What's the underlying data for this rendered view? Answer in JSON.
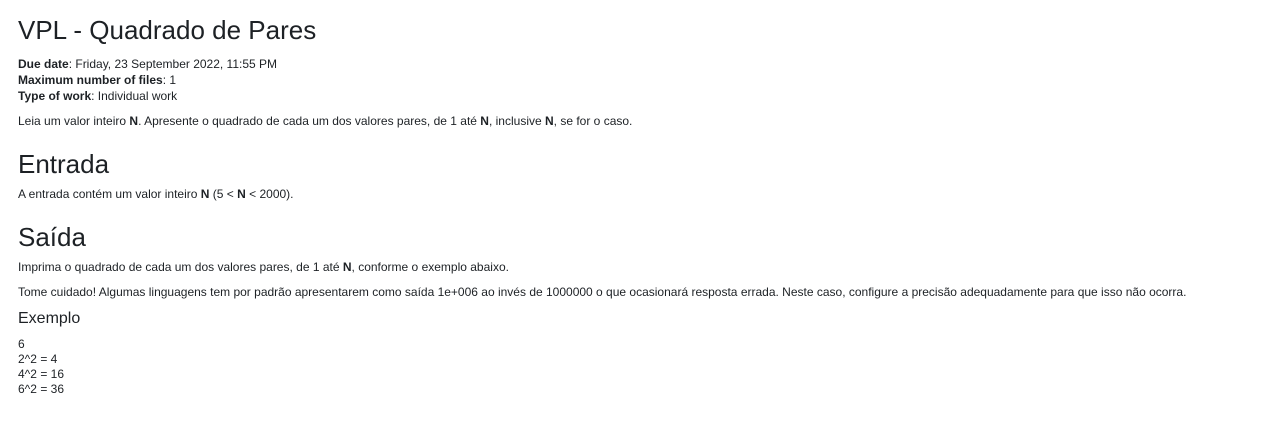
{
  "title": "VPL - Quadrado de Pares",
  "meta": {
    "due_label": "Due date",
    "due_value": "Friday, 23 September 2022, 11:55 PM",
    "max_files_label": "Maximum number of files",
    "max_files_value": "1",
    "work_type_label": "Type of work",
    "work_type_value": "Individual work"
  },
  "description": {
    "p1": "Leia um valor inteiro ",
    "n1": "N",
    "p2": ". Apresente o quadrado de cada um dos valores pares, de 1 até ",
    "n2": "N",
    "p3": ", inclusive ",
    "n3": "N",
    "p4": ", se for o caso."
  },
  "entrada": {
    "heading": "Entrada",
    "p1": "A entrada contém um valor inteiro ",
    "n1": "N",
    "p2": " (5 < ",
    "n2": "N",
    "p3": " < 2000)."
  },
  "saida": {
    "heading": "Saída",
    "line1_a": "Imprima o quadrado de cada um dos valores pares, de 1 até ",
    "line1_n": "N",
    "line1_b": ", conforme o exemplo abaixo.",
    "line2": "Tome cuidado! Algumas linguagens tem por padrão apresentarem como saída 1e+006 ao invés de 1000000 o que ocasionará resposta errada. Neste caso, configure a precisão adequadamente para que isso não ocorra."
  },
  "exemplo": {
    "heading": "Exemplo",
    "lines": [
      "6",
      "2^2 = 4",
      "4^2 = 16",
      "6^2 = 36"
    ]
  }
}
